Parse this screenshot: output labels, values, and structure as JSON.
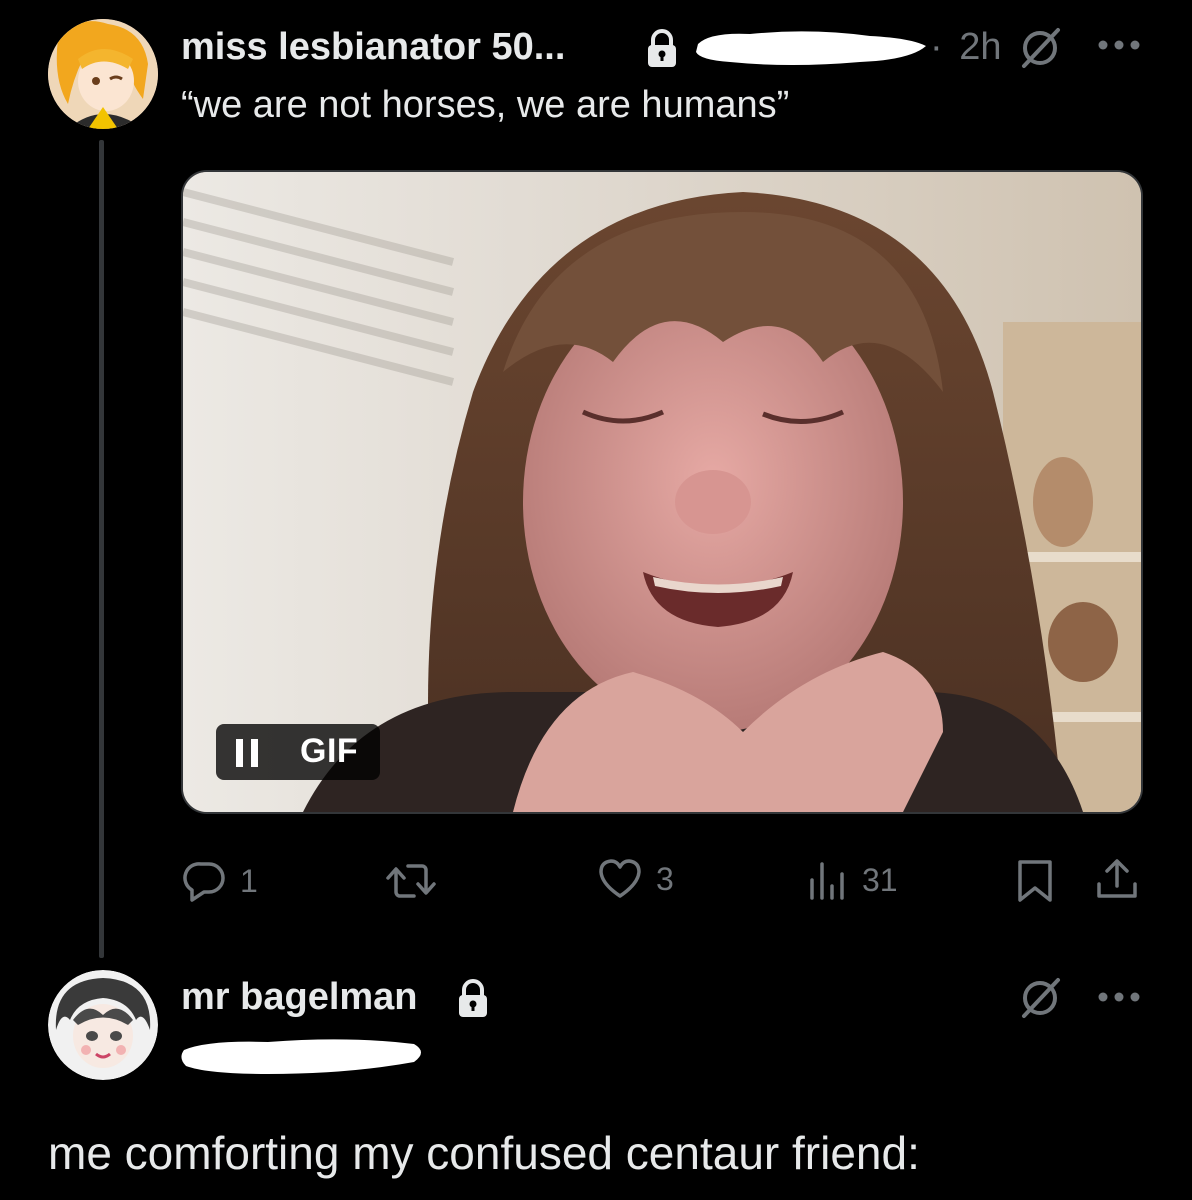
{
  "tweet": {
    "author_name": "miss lesbianator 50...",
    "time": "2h",
    "text": "“we are not horses, we are humans”",
    "media": {
      "badge_label": "GIF",
      "pause_icon": "pause-icon"
    },
    "actions": {
      "replies": "1",
      "reposts": "",
      "likes": "3",
      "views": "31"
    },
    "icons": {
      "lock": "lock-icon",
      "grok": "grok-icon",
      "more": "more-icon",
      "reply": "reply-icon",
      "repost": "repost-icon",
      "like": "heart-icon",
      "views": "views-icon",
      "bookmark": "bookmark-icon",
      "share": "share-icon"
    }
  },
  "reply": {
    "author_name": "mr bagelman",
    "text": "me comforting my confused centaur friend:"
  },
  "colors": {
    "background": "#000000",
    "primary_text": "#e7e9ea",
    "secondary_text": "#71767b",
    "divider": "#333639"
  }
}
